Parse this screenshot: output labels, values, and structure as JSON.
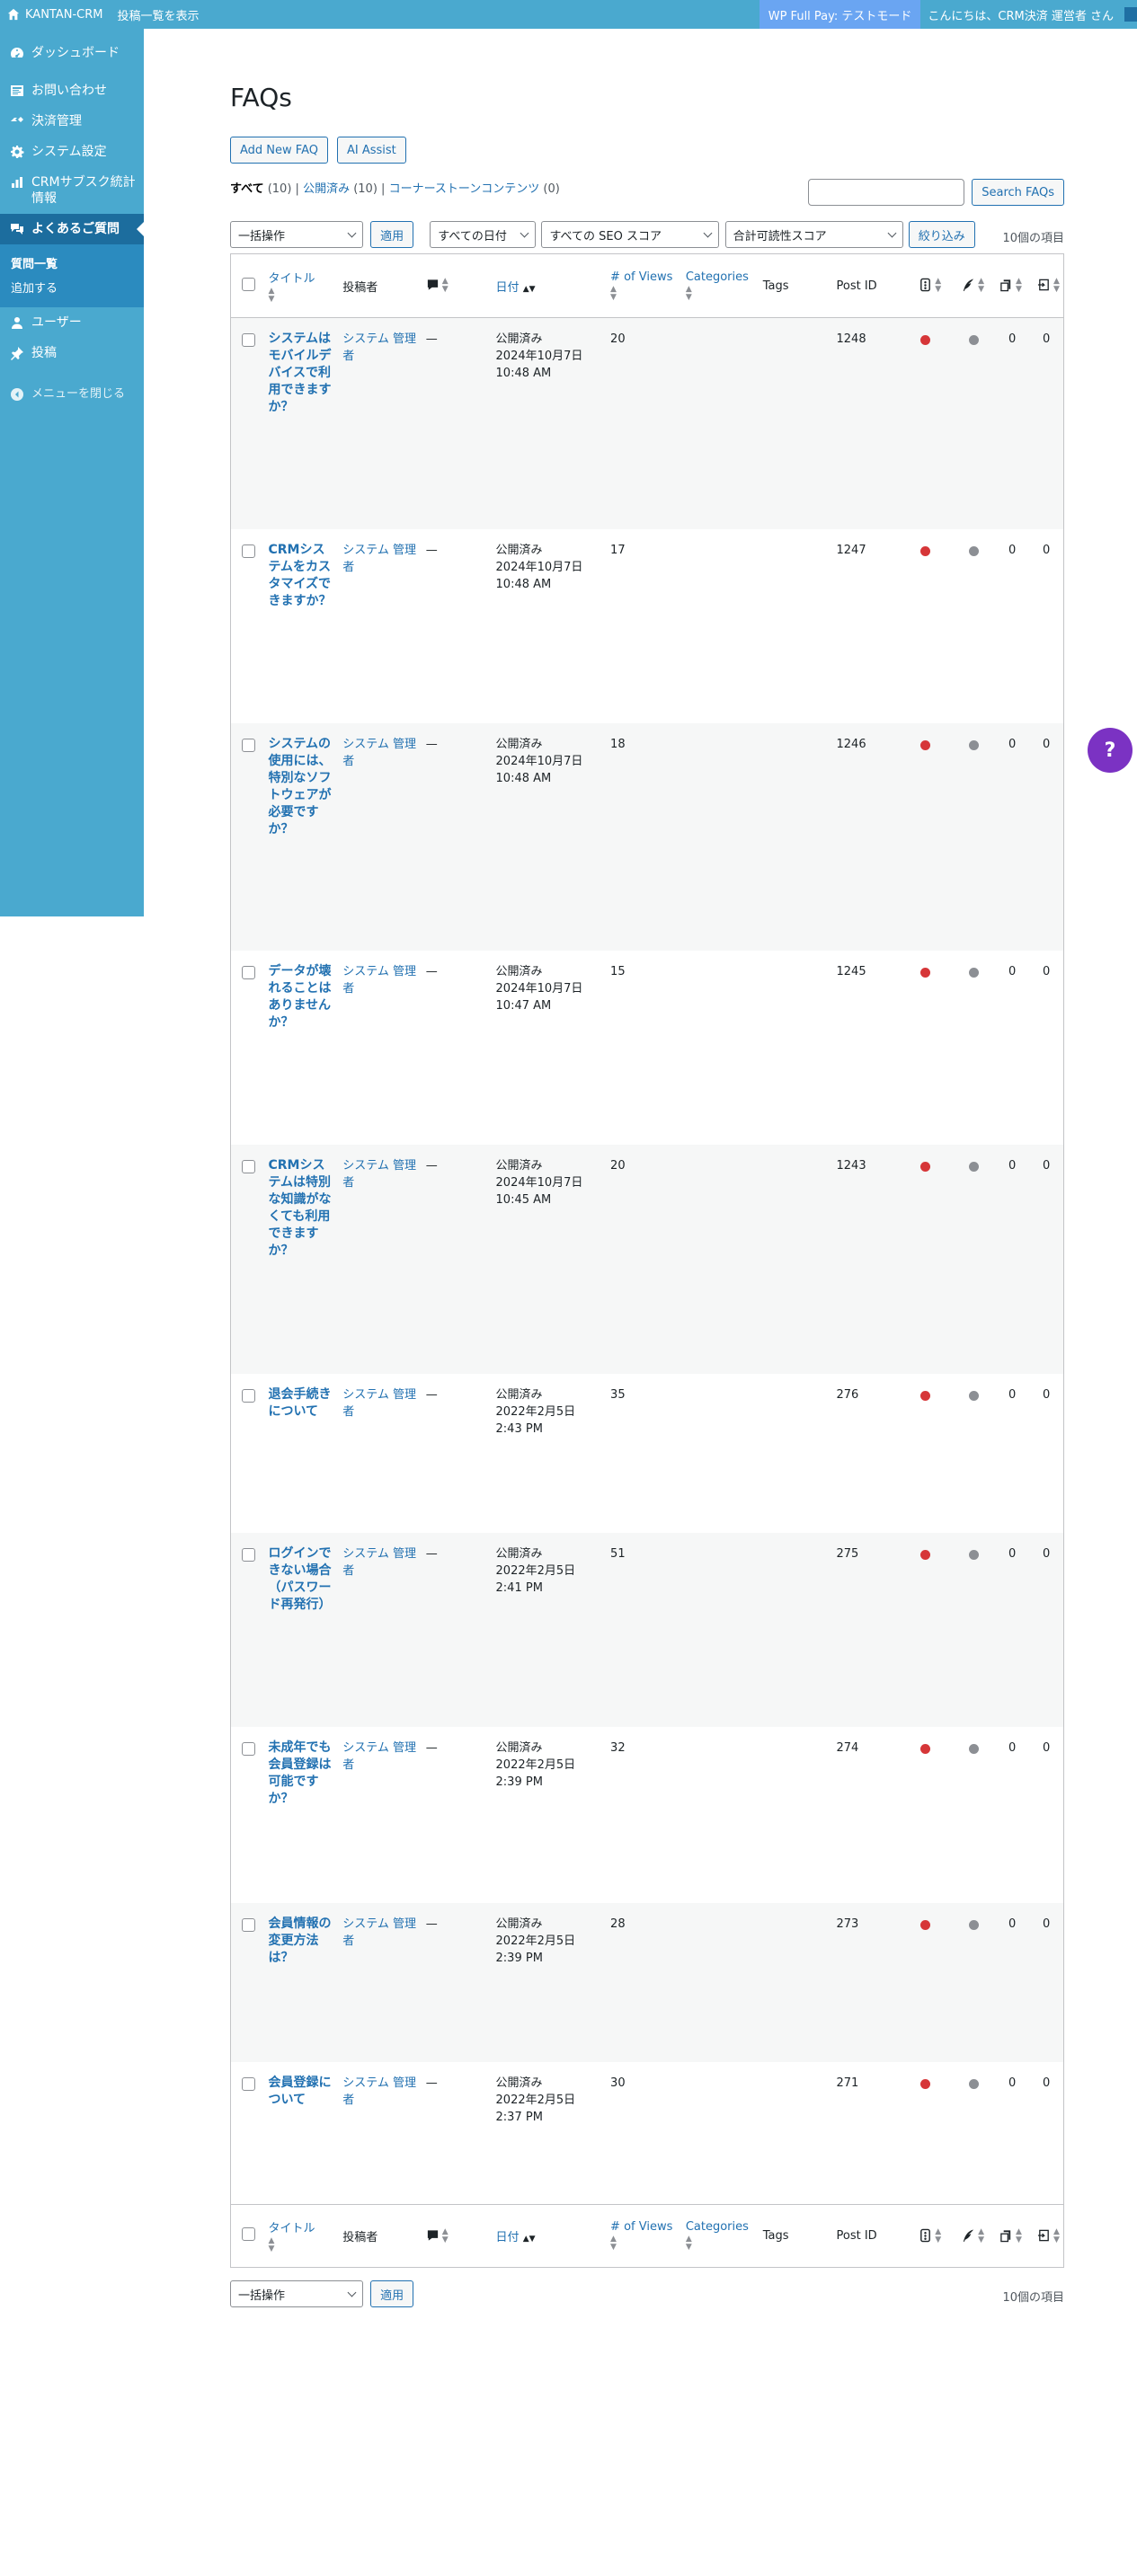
{
  "adminbar": {
    "site_name": "KANTAN-CRM",
    "view_posts": "投稿一覧を表示",
    "test_mode": "WP Full Pay: テストモード",
    "greeting": "こんにちは、CRM決済 運営者 さん"
  },
  "sidebar": {
    "items": [
      {
        "label": "ダッシュボード",
        "icon": "dashboard-icon"
      },
      {
        "label": "お問い合わせ",
        "icon": "contact-form-icon"
      },
      {
        "label": "決済管理",
        "icon": "payment-icon"
      },
      {
        "label": "システム設定",
        "icon": "gear-icon"
      },
      {
        "label": "CRMサブスク統計情報",
        "icon": "bar-chart-icon"
      },
      {
        "label": "よくあるご質問",
        "icon": "faq-icon"
      },
      {
        "label": "ユーザー",
        "icon": "user-icon"
      },
      {
        "label": "投稿",
        "icon": "pin-icon"
      }
    ],
    "submenu": [
      "質問一覧",
      "追加する"
    ],
    "collapse": "メニューを閉じる"
  },
  "page": {
    "title": "FAQs",
    "add_new": "Add New FAQ",
    "ai_assist": "AI Assist",
    "filter_all": "すべて",
    "filter_all_count": "(10)",
    "filter_published": "公開済み",
    "filter_published_count": "(10)",
    "filter_cornerstone": "コーナーストーンコンテンツ",
    "filter_cornerstone_count": "(0)",
    "search_button": "Search FAQs",
    "bulk_action": "一括操作",
    "apply": "適用",
    "date_filter": "すべての日付",
    "seo_filter": "すべての SEO スコア",
    "readability_filter": "合計可読性スコア",
    "filter_button": "絞り込み",
    "item_count": "10個の項目"
  },
  "columns": {
    "title": "タイトル",
    "author": "投稿者",
    "date": "日付",
    "views": "# of Views",
    "categories": "Categories",
    "tags": "Tags",
    "post_id": "Post ID"
  },
  "rows": [
    {
      "title": "システムはモバイルデバイスで利用できますか？",
      "author": "システム 管理者",
      "comments": "—",
      "status": "公開済み",
      "date": "2024年10月7日",
      "time": "10:48 AM",
      "views": "20",
      "post_id": "1248",
      "links_out": "0",
      "links_in": "0"
    },
    {
      "title": "CRMシステムをカスタマイズできますか？",
      "author": "システム 管理者",
      "comments": "—",
      "status": "公開済み",
      "date": "2024年10月7日",
      "time": "10:48 AM",
      "views": "17",
      "post_id": "1247",
      "links_out": "0",
      "links_in": "0"
    },
    {
      "title": "システムの使用には、特別なソフトウェアが必要ですか？",
      "author": "システム 管理者",
      "comments": "—",
      "status": "公開済み",
      "date": "2024年10月7日",
      "time": "10:48 AM",
      "views": "18",
      "post_id": "1246",
      "links_out": "0",
      "links_in": "0"
    },
    {
      "title": "データが壊れることはありませんか？",
      "author": "システム 管理者",
      "comments": "—",
      "status": "公開済み",
      "date": "2024年10月7日",
      "time": "10:47 AM",
      "views": "15",
      "post_id": "1245",
      "links_out": "0",
      "links_in": "0"
    },
    {
      "title": "CRMシステムは特別な知識がなくても利用できますか？",
      "author": "システム 管理者",
      "comments": "—",
      "status": "公開済み",
      "date": "2024年10月7日",
      "time": "10:45 AM",
      "views": "20",
      "post_id": "1243",
      "links_out": "0",
      "links_in": "0"
    },
    {
      "title": "退会手続きについて",
      "author": "システム 管理者",
      "comments": "—",
      "status": "公開済み",
      "date": "2022年2月5日",
      "time": "2:43 PM",
      "views": "35",
      "post_id": "276",
      "links_out": "0",
      "links_in": "0"
    },
    {
      "title": "ログインできない場合（パスワード再発行）",
      "author": "システム 管理者",
      "comments": "—",
      "status": "公開済み",
      "date": "2022年2月5日",
      "time": "2:41 PM",
      "views": "51",
      "post_id": "275",
      "links_out": "0",
      "links_in": "0"
    },
    {
      "title": "未成年でも会員登録は可能ですか？",
      "author": "システム 管理者",
      "comments": "—",
      "status": "公開済み",
      "date": "2022年2月5日",
      "time": "2:39 PM",
      "views": "32",
      "post_id": "274",
      "links_out": "0",
      "links_in": "0"
    },
    {
      "title": "会員情報の変更方法は？",
      "author": "システム 管理者",
      "comments": "—",
      "status": "公開済み",
      "date": "2022年2月5日",
      "time": "2:39 PM",
      "views": "28",
      "post_id": "273",
      "links_out": "0",
      "links_in": "0"
    },
    {
      "title": "会員登録について",
      "author": "システム 管理者",
      "comments": "—",
      "status": "公開済み",
      "date": "2022年2月5日",
      "time": "2:37 PM",
      "views": "30",
      "post_id": "271",
      "links_out": "0",
      "links_in": "0"
    }
  ],
  "help_button": "?",
  "colors": {
    "adminbar": "#4aa9cf",
    "sidebar": "#4aa9cf",
    "current_menu": "#1c6d9e",
    "link": "#2271b1",
    "seo_dot": "#d63638",
    "readability_dot": "#8c8f94",
    "help": "#7b32c3"
  }
}
